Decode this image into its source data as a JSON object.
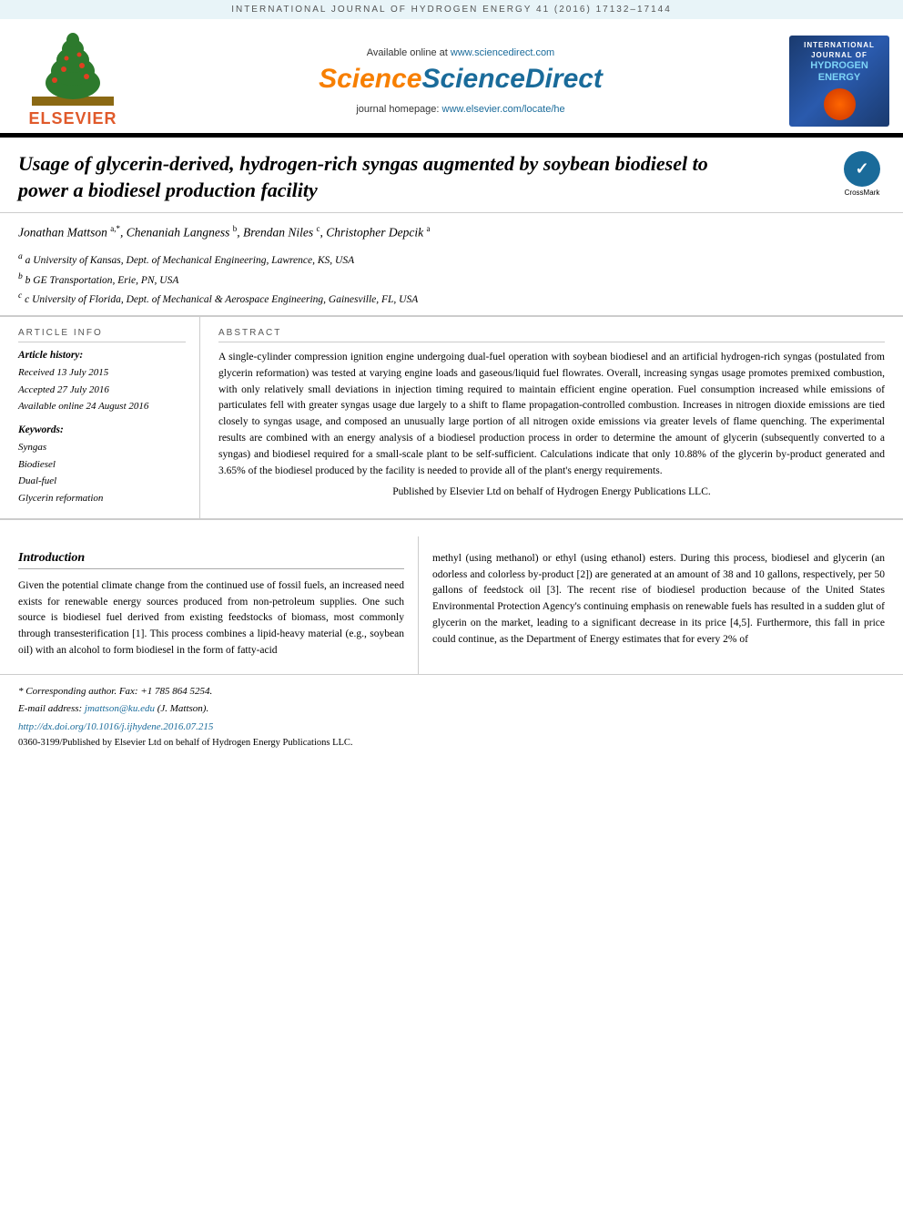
{
  "journal_bar": {
    "text": "INTERNATIONAL JOURNAL OF HYDROGEN ENERGY 41 (2016) 17132–17144"
  },
  "header": {
    "available_online_text": "Available online at",
    "available_online_url": "www.sciencedirect.com",
    "sciencedirect_label": "ScienceDirect",
    "journal_homepage_text": "journal homepage:",
    "journal_homepage_url": "www.elsevier.com/locate/he",
    "elsevier_label": "ELSEVIER",
    "journal_cover_line1": "INTERNATIONAL",
    "journal_cover_line2": "JOURNAL OF",
    "journal_cover_title": "HYDROGEN ENERGY"
  },
  "title": {
    "text": "Usage of glycerin-derived, hydrogen-rich syngas augmented by soybean biodiesel to power a biodiesel production facility"
  },
  "crossmark": {
    "label": "CrossMark"
  },
  "authors": {
    "line": "Jonathan Mattson a,*, Chenaniah Langness b, Brendan Niles c, Christopher Depcik a",
    "affiliations": [
      "a University of Kansas, Dept. of Mechanical Engineering, Lawrence, KS, USA",
      "b GE Transportation, Erie, PN, USA",
      "c University of Florida, Dept. of Mechanical & Aerospace Engineering, Gainesville, FL, USA"
    ]
  },
  "article_info": {
    "heading": "ARTICLE INFO",
    "history_label": "Article history:",
    "received": "Received 13 July 2015",
    "accepted": "Accepted 27 July 2016",
    "available": "Available online 24 August 2016",
    "keywords_label": "Keywords:",
    "keywords": [
      "Syngas",
      "Biodiesel",
      "Dual-fuel",
      "Glycerin reformation"
    ]
  },
  "abstract": {
    "heading": "ABSTRACT",
    "text": "A single-cylinder compression ignition engine undergoing dual-fuel operation with soybean biodiesel and an artificial hydrogen-rich syngas (postulated from glycerin reformation) was tested at varying engine loads and gaseous/liquid fuel flowrates. Overall, increasing syngas usage promotes premixed combustion, with only relatively small deviations in injection timing required to maintain efficient engine operation. Fuel consumption increased while emissions of particulates fell with greater syngas usage due largely to a shift to flame propagation-controlled combustion. Increases in nitrogen dioxide emissions are tied closely to syngas usage, and composed an unusually large portion of all nitrogen oxide emissions via greater levels of flame quenching. The experimental results are combined with an energy analysis of a biodiesel production process in order to determine the amount of glycerin (subsequently converted to a syngas) and biodiesel required for a small-scale plant to be self-sufficient. Calculations indicate that only 10.88% of the glycerin by-product generated and 3.65% of the biodiesel produced by the facility is needed to provide all of the plant's energy requirements.",
    "published": "Published by Elsevier Ltd on behalf of Hydrogen Energy Publications LLC."
  },
  "introduction": {
    "title": "Introduction",
    "left_text": "Given the potential climate change from the continued use of fossil fuels, an increased need exists for renewable energy sources produced from non-petroleum supplies. One such source is biodiesel fuel derived from existing feedstocks of biomass, most commonly through transesterification [1]. This process combines a lipid-heavy material (e.g., soybean oil) with an alcohol to form biodiesel in the form of fatty-acid",
    "right_text": "methyl (using methanol) or ethyl (using ethanol) esters. During this process, biodiesel and glycerin (an odorless and colorless by-product [2]) are generated at an amount of 38 and 10 gallons, respectively, per 50 gallons of feedstock oil [3]. The recent rise of biodiesel production because of the United States Environmental Protection Agency's continuing emphasis on renewable fuels has resulted in a sudden glut of glycerin on the market, leading to a significant decrease in its price [4,5]. Furthermore, this fall in price could continue, as the Department of Energy estimates that for every 2% of"
  },
  "footer": {
    "corresponding_author": "* Corresponding author. Fax: +1 785 864 5254.",
    "email_label": "E-mail address:",
    "email": "jmattson@ku.edu",
    "email_person": "(J. Mattson).",
    "doi_url": "http://dx.doi.org/10.1016/j.ijhydene.2016.07.215",
    "issn": "0360-3199/Published by Elsevier Ltd on behalf of Hydrogen Energy Publications LLC."
  }
}
